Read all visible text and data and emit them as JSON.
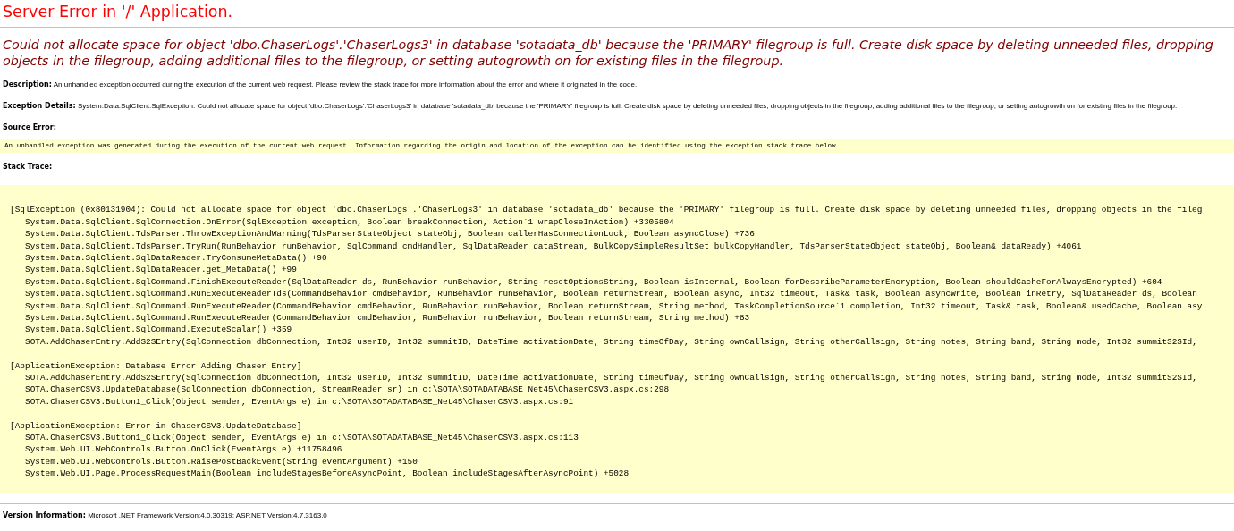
{
  "title": "Server Error in '/' Application.",
  "message": "Could not allocate space for object 'dbo.ChaserLogs'.'ChaserLogs3' in database 'sotadata_db' because the 'PRIMARY' filegroup is full. Create disk space by deleting unneeded files, dropping objects in the filegroup, adding additional files to the filegroup, or setting autogrowth on for existing files in the filegroup.",
  "description": {
    "label": "Description:",
    "text": "An unhandled exception occurred during the execution of the current web request. Please review the stack trace for more information about the error and where it originated in the code."
  },
  "exception_details": {
    "label": "Exception Details:",
    "text": "System.Data.SqlClient.SqlException: Could not allocate space for object 'dbo.ChaserLogs'.'ChaserLogs3' in database 'sotadata_db' because the 'PRIMARY' filegroup is full. Create disk space by deleting unneeded files, dropping objects in the filegroup, adding additional files to the filegroup, or setting autogrowth on for existing files in the filegroup."
  },
  "source_error": {
    "label": "Source Error:",
    "text": "An unhandled exception was generated during the execution of the current web request. Information regarding the origin and location of the exception can be identified using the exception stack trace below."
  },
  "stack_trace": {
    "label": "Stack Trace:",
    "groups": [
      {
        "header": "[SqlException (0x80131904): Could not allocate space for object 'dbo.ChaserLogs'.'ChaserLogs3' in database 'sotadata_db' because the 'PRIMARY' filegroup is full. Create disk space by deleting unneeded files, dropping objects in the fileg",
        "frames": [
          "System.Data.SqlClient.SqlConnection.OnError(SqlException exception, Boolean breakConnection, Action`1 wrapCloseInAction) +3305804",
          "System.Data.SqlClient.TdsParser.ThrowExceptionAndWarning(TdsParserStateObject stateObj, Boolean callerHasConnectionLock, Boolean asyncClose) +736",
          "System.Data.SqlClient.TdsParser.TryRun(RunBehavior runBehavior, SqlCommand cmdHandler, SqlDataReader dataStream, BulkCopySimpleResultSet bulkCopyHandler, TdsParserStateObject stateObj, Boolean& dataReady) +4061",
          "System.Data.SqlClient.SqlDataReader.TryConsumeMetaData() +90",
          "System.Data.SqlClient.SqlDataReader.get_MetaData() +99",
          "System.Data.SqlClient.SqlCommand.FinishExecuteReader(SqlDataReader ds, RunBehavior runBehavior, String resetOptionsString, Boolean isInternal, Boolean forDescribeParameterEncryption, Boolean shouldCacheForAlwaysEncrypted) +604",
          "System.Data.SqlClient.SqlCommand.RunExecuteReaderTds(CommandBehavior cmdBehavior, RunBehavior runBehavior, Boolean returnStream, Boolean async, Int32 timeout, Task& task, Boolean asyncWrite, Boolean inRetry, SqlDataReader ds, Boolean",
          "System.Data.SqlClient.SqlCommand.RunExecuteReader(CommandBehavior cmdBehavior, RunBehavior runBehavior, Boolean returnStream, String method, TaskCompletionSource`1 completion, Int32 timeout, Task& task, Boolean& usedCache, Boolean asy",
          "System.Data.SqlClient.SqlCommand.RunExecuteReader(CommandBehavior cmdBehavior, RunBehavior runBehavior, Boolean returnStream, String method) +83",
          "System.Data.SqlClient.SqlCommand.ExecuteScalar() +359",
          "SOTA.AddChaserEntry.AddS2SEntry(SqlConnection dbConnection, Int32 userID, Int32 summitID, DateTime activationDate, String timeOfDay, String ownCallsign, String otherCallsign, String notes, String band, String mode, Int32 summitS2SId,"
        ]
      },
      {
        "header": "[ApplicationException: Database Error Adding Chaser Entry]",
        "frames": [
          "SOTA.AddChaserEntry.AddS2SEntry(SqlConnection dbConnection, Int32 userID, Int32 summitID, DateTime activationDate, String timeOfDay, String ownCallsign, String otherCallsign, String notes, String band, String mode, Int32 summitS2SId,",
          "SOTA.ChaserCSV3.UpdateDatabase(SqlConnection dbConnection, StreamReader sr) in c:\\SOTA\\SOTADATABASE_Net45\\ChaserCSV3.aspx.cs:298",
          "SOTA.ChaserCSV3.Button1_Click(Object sender, EventArgs e) in c:\\SOTA\\SOTADATABASE_Net45\\ChaserCSV3.aspx.cs:91"
        ]
      },
      {
        "header": "[ApplicationException: Error in ChaserCSV3.UpdateDatabase]",
        "frames": [
          "SOTA.ChaserCSV3.Button1_Click(Object sender, EventArgs e) in c:\\SOTA\\SOTADATABASE_Net45\\ChaserCSV3.aspx.cs:113",
          "System.Web.UI.WebControls.Button.OnClick(EventArgs e) +11758496",
          "System.Web.UI.WebControls.Button.RaisePostBackEvent(String eventArgument) +150",
          "System.Web.UI.Page.ProcessRequestMain(Boolean includeStagesBeforeAsyncPoint, Boolean includeStagesAfterAsyncPoint) +5028"
        ]
      }
    ]
  },
  "version": {
    "label": "Version Information:",
    "text": "Microsoft .NET Framework Version:4.0.30319; ASP.NET Version:4.7.3163.0"
  }
}
